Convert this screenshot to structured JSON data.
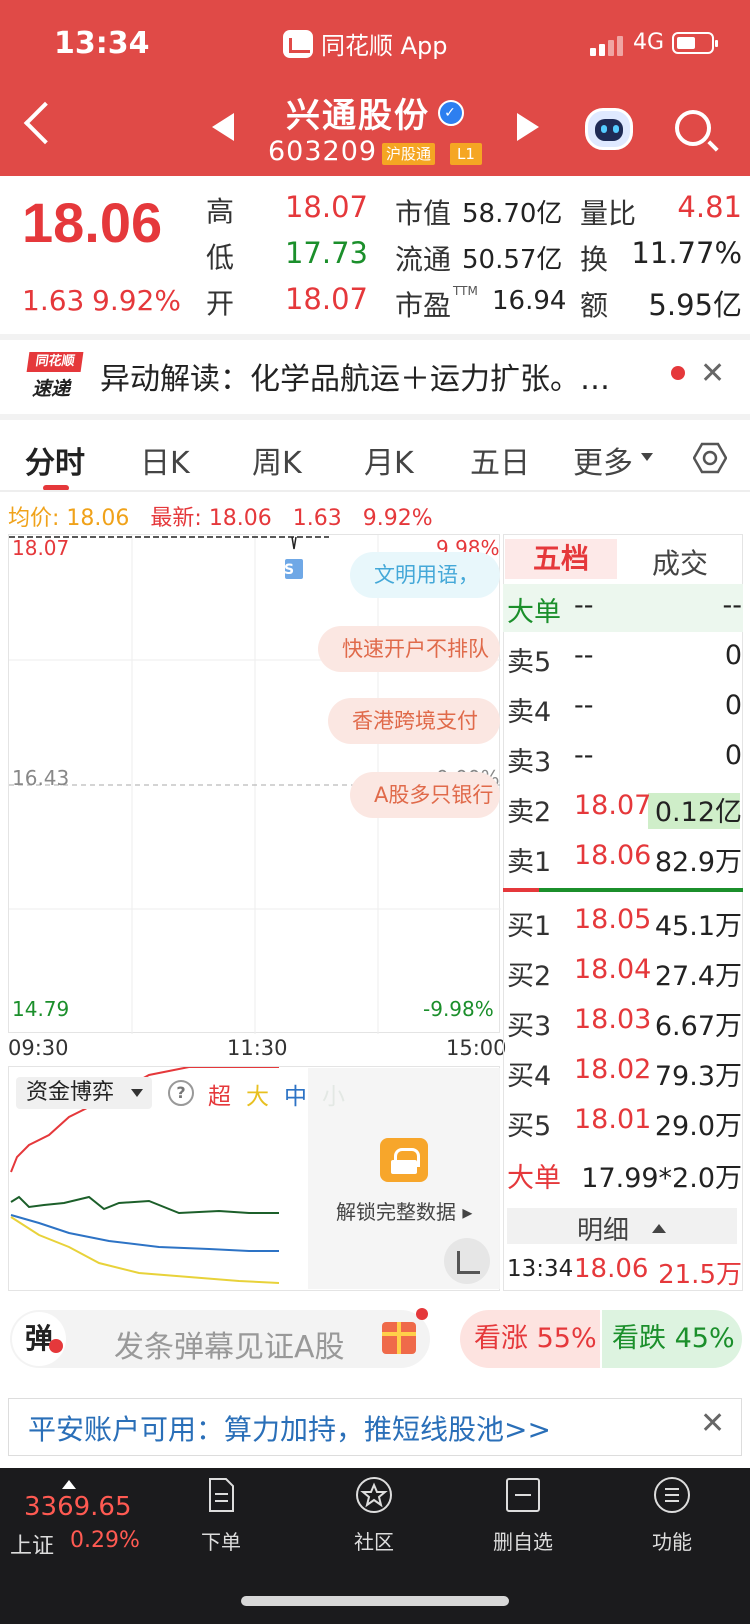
{
  "status": {
    "time": "13:34",
    "app": "同花顺 App",
    "network": "4G"
  },
  "header": {
    "name": "兴通股份",
    "code": "603209",
    "tag1": "沪股通",
    "tag2": "L1"
  },
  "quote": {
    "price": "18.06",
    "change": "1.63",
    "change_pct": "9.92%",
    "high_label": "高",
    "high": "18.07",
    "low_label": "低",
    "low": "17.73",
    "open_label": "开",
    "open": "18.07",
    "mcap_label": "市值",
    "mcap": "58.70亿",
    "float_label": "流通",
    "float": "50.57亿",
    "pe_label": "市盈",
    "pe_sup": "TTM",
    "pe": "16.94",
    "vr_label": "量比",
    "vr": "4.81",
    "turn_label": "换",
    "turn": "11.77%",
    "amt_label": "额",
    "amt": "5.95亿"
  },
  "news": {
    "logo_top": "同花顺",
    "logo_bottom": "速递",
    "text": "异动解读：化学品航运＋运力扩张。…"
  },
  "tabs": [
    "分时",
    "日K",
    "周K",
    "月K",
    "五日",
    "更多"
  ],
  "chart_info": {
    "avg_label": "均价:",
    "avg": "18.06",
    "latest_label": "最新:",
    "latest": "18.06",
    "chg": "1.63",
    "pct": "9.92%"
  },
  "chart": {
    "y_max": "18.07",
    "y_mid": "16.43",
    "y_min": "14.79",
    "pct_max": "9.98%",
    "pct_mid": "0.00%",
    "pct_min": "-9.98%",
    "times": [
      "09:30",
      "11:30",
      "15:00"
    ],
    "marker": "S",
    "bullets": [
      "文明用语，",
      "快速开户不排队",
      "香港跨境支付",
      "A股多只银行"
    ]
  },
  "fund": {
    "select": "资金博弈",
    "legend": [
      "超",
      "大",
      "中",
      "小"
    ],
    "unlock": "解锁完整数据 ▸"
  },
  "orderbook": {
    "tab_active": "五档",
    "tab_other": "成交",
    "dadan_label": "大单",
    "dadan_price": "--",
    "dadan_vol": "--",
    "sells": [
      {
        "label": "卖5",
        "price": "--",
        "vol": "0"
      },
      {
        "label": "卖4",
        "price": "--",
        "vol": "0"
      },
      {
        "label": "卖3",
        "price": "--",
        "vol": "0"
      },
      {
        "label": "卖2",
        "price": "18.07",
        "vol": "0.12亿"
      },
      {
        "label": "卖1",
        "price": "18.06",
        "vol": "82.9万"
      }
    ],
    "buys": [
      {
        "label": "买1",
        "price": "18.05",
        "vol": "45.1万"
      },
      {
        "label": "买2",
        "price": "18.04",
        "vol": "27.4万"
      },
      {
        "label": "买3",
        "price": "18.03",
        "vol": "6.67万"
      },
      {
        "label": "买4",
        "price": "18.02",
        "vol": "79.3万"
      },
      {
        "label": "买5",
        "price": "18.01",
        "vol": "29.0万"
      }
    ],
    "bottom_dadan_label": "大单",
    "bottom_dadan_value": "17.99*2.0万",
    "detail_label": "明细",
    "last_trade": {
      "time": "13:34",
      "price": "18.06",
      "vol": "21.5万"
    }
  },
  "danmu": {
    "btn": "弹",
    "placeholder": "发条弹幕见证A股",
    "up": "看涨 55%",
    "down": "看跌 45%"
  },
  "banner": {
    "text": "平安账户可用：算力加持，推短线股池>>"
  },
  "bottom": {
    "index_value": "3369.65",
    "index_name": "上证",
    "index_pct": "0.29%",
    "nav": [
      "下单",
      "社区",
      "删自选",
      "功能"
    ]
  },
  "colors": {
    "brand": "#e04a47",
    "up": "#e5383b",
    "down": "#1b8f2b",
    "avg": "#f0a21a"
  }
}
